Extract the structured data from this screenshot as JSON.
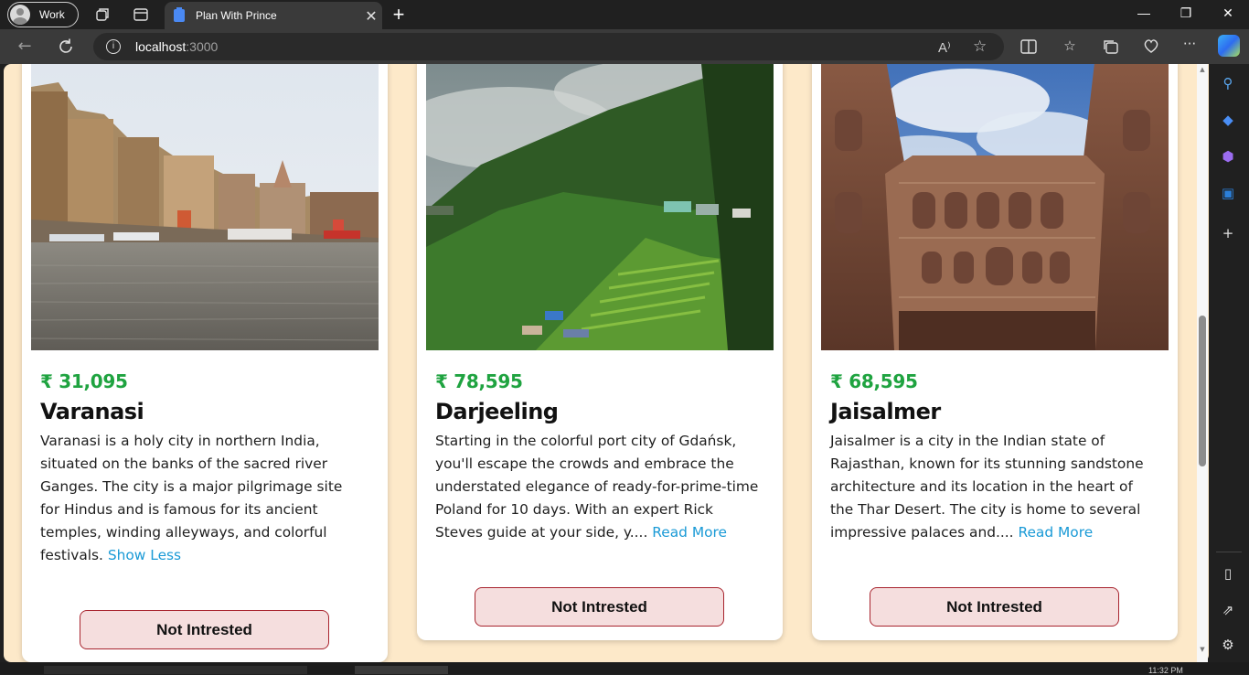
{
  "browser": {
    "profile_label": "Work",
    "tab_title": "Plan With Prince",
    "tab_close": "✕",
    "new_tab": "+",
    "url_host": "localhost",
    "url_port": ":3000",
    "read_aloud": "A⁾"
  },
  "window_controls": {
    "minimize": "—",
    "maximize": "❐",
    "close": "✕"
  },
  "cards": [
    {
      "price": "₹ 31,095",
      "city": "Varanasi",
      "description": "Varanasi is a holy city in northern India, situated on the banks of the sacred river Ganges. The city is a major pilgrimage site for Hindus and is famous for its ancient temples, winding alleyways, and colorful festivals. ",
      "link": "Show Less",
      "button": "Not Intrested"
    },
    {
      "price": "₹ 78,595",
      "city": "Darjeeling",
      "description": "Starting in the colorful port city of Gdańsk, you'll escape the crowds and embrace the understated elegance of ready-for-prime-time Poland for 10 days. With an expert Rick Steves guide at your side, y.... ",
      "link": "Read More",
      "button": "Not Intrested"
    },
    {
      "price": "₹ 68,595",
      "city": "Jaisalmer",
      "description": "Jaisalmer is a city in the Indian state of Rajasthan, known for its stunning sandstone architecture and its location in the heart of the Thar Desert. The city is home to several impressive palaces and.... ",
      "link": "Read More",
      "button": "Not Intrested"
    }
  ],
  "taskbar": {
    "clock": "11:32 PM"
  },
  "colors": {
    "page_bg": "#fde9c9",
    "price": "#1fa340",
    "link": "#1a9ad6",
    "button_bg": "#f5dede",
    "button_border": "#a8242e"
  }
}
